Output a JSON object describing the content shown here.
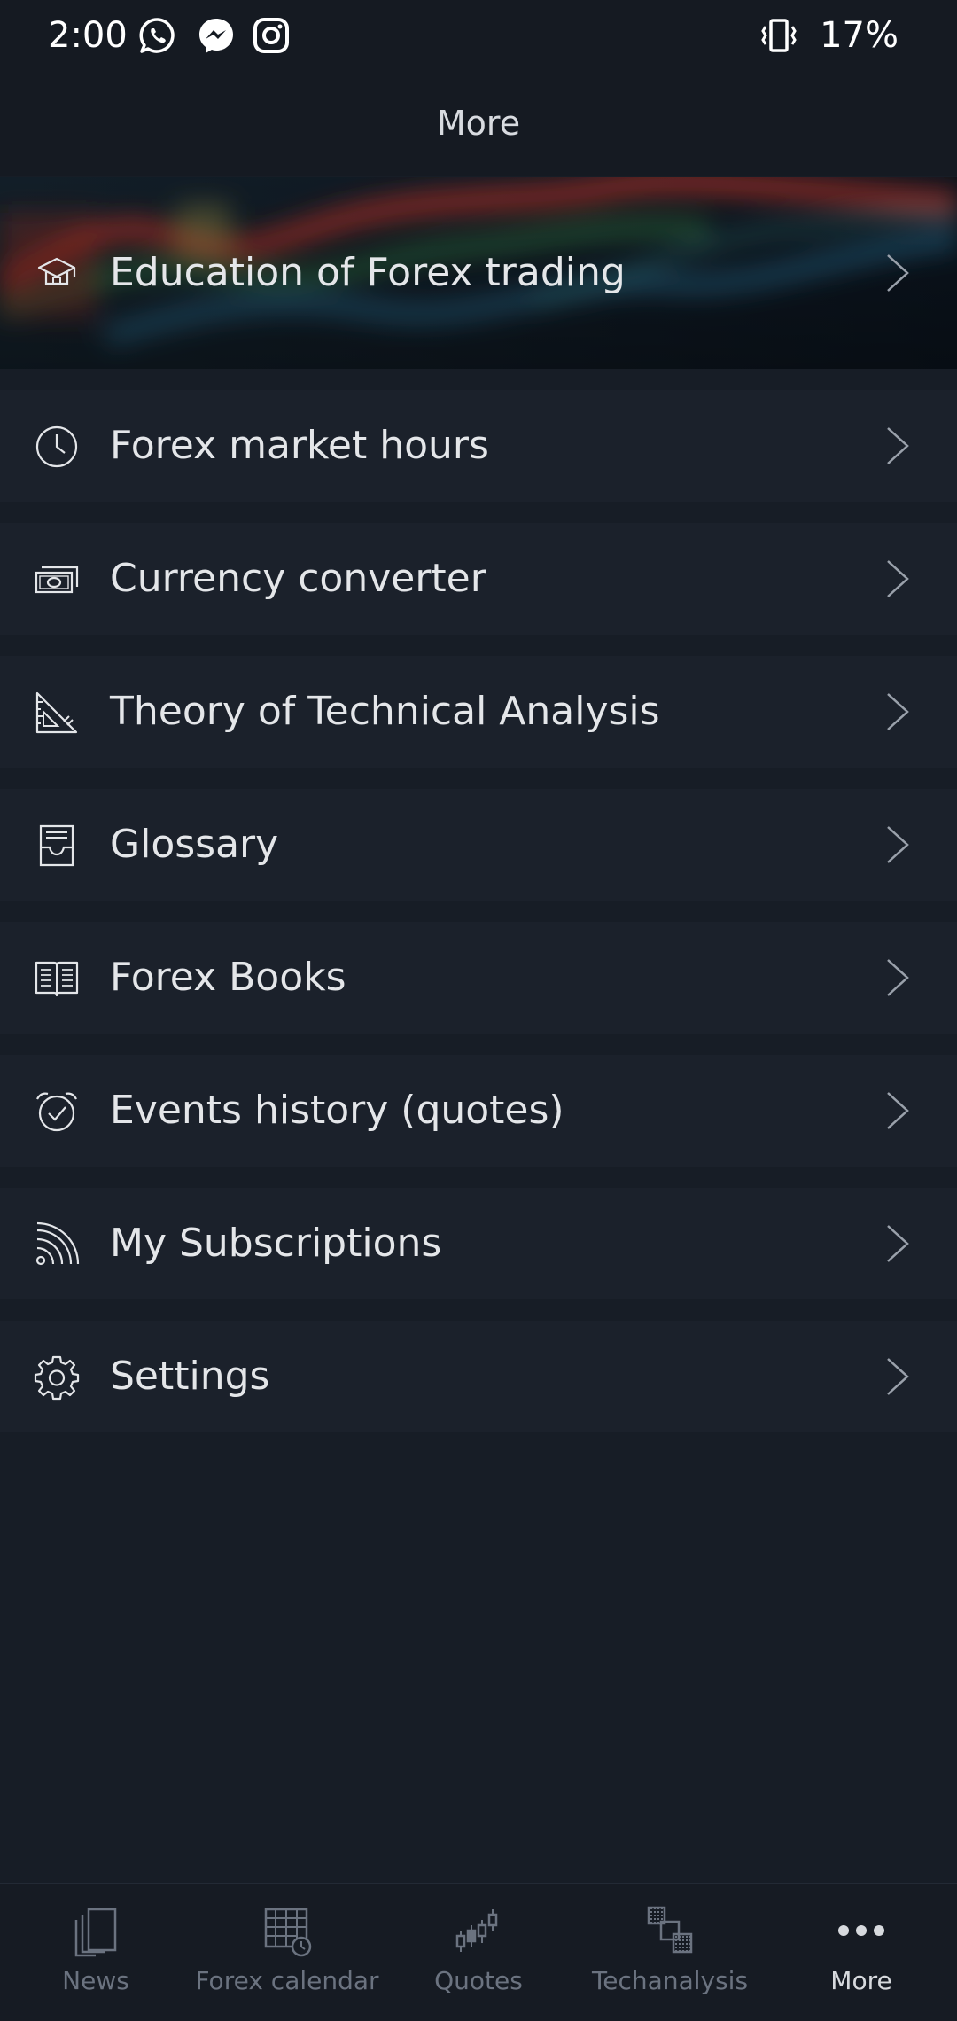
{
  "status_bar": {
    "time": "2:00",
    "battery": "17%",
    "notification_icons": [
      "whatsapp-icon",
      "messenger-icon",
      "instagram-icon"
    ],
    "system_icons": [
      "vibrate-icon"
    ]
  },
  "header": {
    "title": "More"
  },
  "menu": {
    "items": [
      {
        "label": "Education of Forex trading",
        "icon": "graduation-cap-icon"
      },
      {
        "label": "Forex market hours",
        "icon": "clock-icon"
      },
      {
        "label": "Currency converter",
        "icon": "banknote-icon"
      },
      {
        "label": "Theory of Technical Analysis",
        "icon": "set-square-icon"
      },
      {
        "label": "Glossary",
        "icon": "inbox-tray-icon"
      },
      {
        "label": "Forex Books",
        "icon": "open-book-icon"
      },
      {
        "label": "Events history (quotes)",
        "icon": "alarm-clock-icon"
      },
      {
        "label": "My Subscriptions",
        "icon": "rss-feed-icon"
      },
      {
        "label": "Settings",
        "icon": "gear-icon"
      }
    ]
  },
  "bottom_nav": {
    "items": [
      {
        "label": "News",
        "icon": "news-pages-icon"
      },
      {
        "label": "Forex calendar",
        "icon": "calendar-grid-icon"
      },
      {
        "label": "Quotes",
        "icon": "candlestick-icon"
      },
      {
        "label": "Techanalysis",
        "icon": "analysis-blocks-icon"
      },
      {
        "label": "More",
        "icon": "more-dots-icon"
      }
    ],
    "active": "More"
  },
  "colors": {
    "background": "#171d26",
    "bar": "#151a22",
    "row": "#1b212b",
    "text": "#e4e6e9",
    "inactive_nav": "#6b7380"
  }
}
